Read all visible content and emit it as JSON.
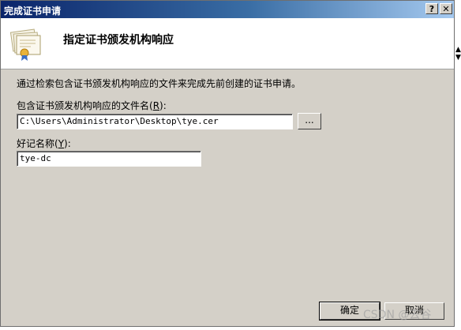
{
  "window": {
    "title": "完成证书申请",
    "help_label": "?",
    "close_label": "✕"
  },
  "header": {
    "title": "指定证书颁发机构响应",
    "icon": "certificate-icon"
  },
  "body": {
    "instructions": "通过检索包含证书颁发机构响应的文件来完成先前创建的证书申请。",
    "file_label": "包含证书颁发机构响应的文件名(",
    "file_accel": "R",
    "file_label_end": "):",
    "file_value": "C:\\Users\\Administrator\\Desktop\\tye.cer",
    "browse_label": "...",
    "name_label": "好记名称(",
    "name_accel": "Y",
    "name_label_end": "):",
    "name_value": "tye-dc"
  },
  "footer": {
    "ok_label": "确定",
    "cancel_label": "取消"
  },
  "watermark": "CSDN @去谷",
  "colors": {
    "dialog_bg": "#d4d0c8",
    "titlebar_start": "#0a246a",
    "titlebar_end": "#a6caf0"
  }
}
